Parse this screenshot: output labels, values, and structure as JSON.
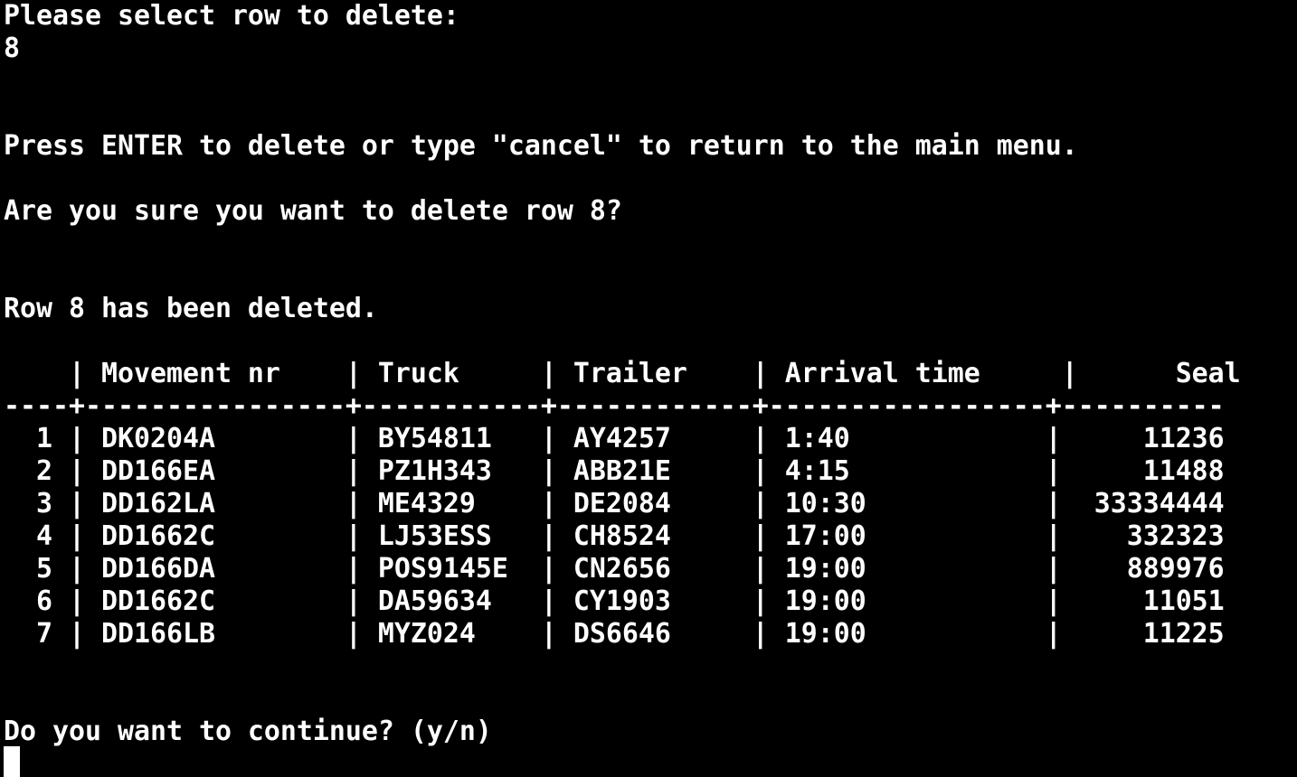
{
  "colors": {
    "background": "#000000",
    "foreground": "#ffffff"
  },
  "prompt_select": "Please select row to delete:",
  "input_value": "8",
  "press_enter_msg": "Press ENTER to delete or type \"cancel\" to return to the main menu.",
  "confirm_msg": "Are you sure you want to delete row 8?",
  "deleted_msg": "Row 8 has been deleted.",
  "table": {
    "header": "    | Movement nr    | Truck     | Trailer    | Arrival time     |      Seal",
    "separator": "----+----------------+-----------+------------+-----------------+----------",
    "rows": [
      "  1 | DK0204A        | BY54811   | AY4257     | 1:40            |     11236",
      "  2 | DD166EA        | PZ1H343   | ABB21E     | 4:15            |     11488",
      "  3 | DD162LA        | ME4329    | DE2084     | 10:30           |  33334444",
      "  4 | DD1662C        | LJ53ESS   | CH8524     | 17:00           |    332323",
      "  5 | DD166DA        | POS9145E  | CN2656     | 19:00           |    889976",
      "  6 | DD1662C        | DA59634   | CY1903     | 19:00           |     11051",
      "  7 | DD166LB        | MYZ024    | DS6646     | 19:00           |     11225"
    ]
  },
  "continue_prompt": "Do you want to continue? (y/n)"
}
